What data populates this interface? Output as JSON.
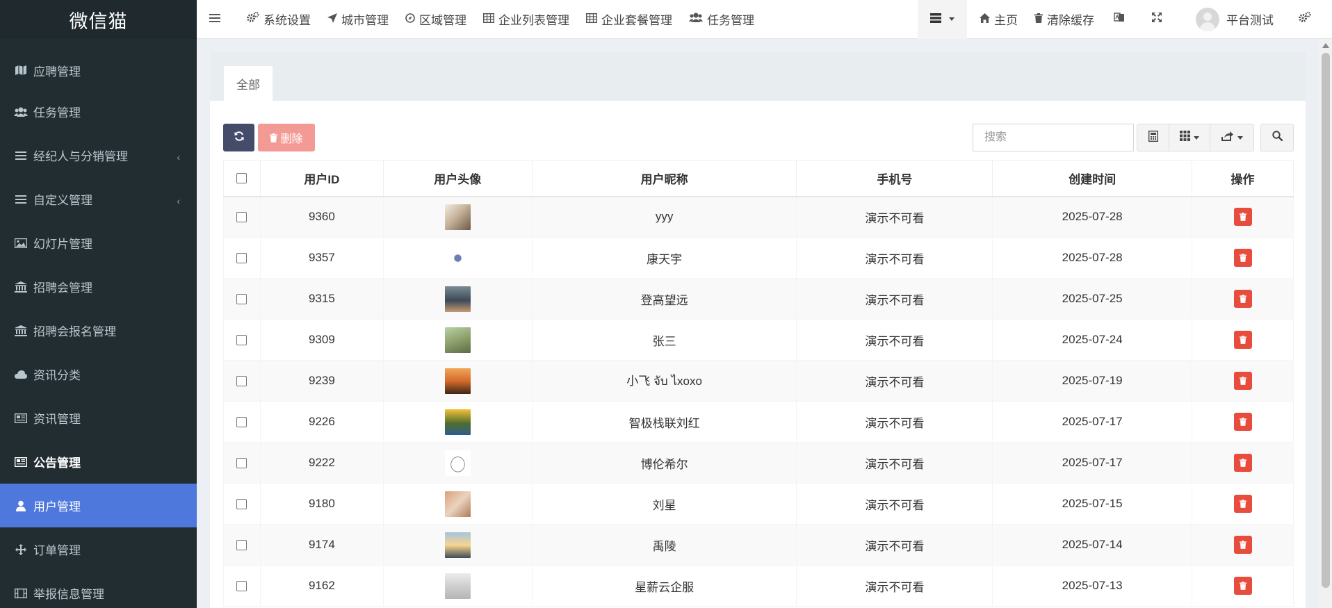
{
  "app": {
    "logo": "微信猫"
  },
  "sidebar": {
    "items": [
      {
        "label": "应聘管理",
        "icon": "map-icon"
      },
      {
        "label": "任务管理",
        "icon": "users-icon"
      },
      {
        "label": "经纪人与分销管理",
        "icon": "list-icon",
        "expandable": true
      },
      {
        "label": "自定义管理",
        "icon": "list-icon",
        "expandable": true
      },
      {
        "label": "幻灯片管理",
        "icon": "image-icon"
      },
      {
        "label": "招聘会管理",
        "icon": "bank-icon"
      },
      {
        "label": "招聘会报名管理",
        "icon": "bank-icon"
      },
      {
        "label": "资讯分类",
        "icon": "cloud-icon"
      },
      {
        "label": "资讯管理",
        "icon": "newspaper-icon"
      },
      {
        "label": "公告管理",
        "icon": "newspaper-icon",
        "highlighted": true
      },
      {
        "label": "用户管理",
        "icon": "user-icon",
        "active": true
      },
      {
        "label": "订单管理",
        "icon": "arrows-icon"
      },
      {
        "label": "举报信息管理",
        "icon": "film-icon"
      }
    ]
  },
  "topnav": {
    "menu": [
      "系统设置",
      "城市管理",
      "区域管理",
      "企业列表管理",
      "企业套餐管理",
      "任务管理"
    ],
    "home": "主页",
    "clear_cache": "清除缓存",
    "user_name": "平台测试"
  },
  "panel": {
    "tab_all": "全部"
  },
  "toolbar": {
    "delete_label": "删除",
    "search_placeholder": "搜索"
  },
  "table": {
    "columns": [
      "用户ID",
      "用户头像",
      "用户昵称",
      "手机号",
      "创建时间",
      "操作"
    ],
    "rows": [
      {
        "id": "9360",
        "nickname": "yyy",
        "phone": "演示不可看",
        "created": "2025-07-28"
      },
      {
        "id": "9357",
        "nickname": "康天宇",
        "phone": "演示不可看",
        "created": "2025-07-28"
      },
      {
        "id": "9315",
        "nickname": "登高望远",
        "phone": "演示不可看",
        "created": "2025-07-25"
      },
      {
        "id": "9309",
        "nickname": "张三",
        "phone": "演示不可看",
        "created": "2025-07-24"
      },
      {
        "id": "9239",
        "nickname": "小飞 จับ ไxoxo",
        "phone": "演示不可看",
        "created": "2025-07-19"
      },
      {
        "id": "9226",
        "nickname": "智极栈联刘红",
        "phone": "演示不可看",
        "created": "2025-07-17"
      },
      {
        "id": "9222",
        "nickname": "博伦希尔",
        "phone": "演示不可看",
        "created": "2025-07-17"
      },
      {
        "id": "9180",
        "nickname": "刘星",
        "phone": "演示不可看",
        "created": "2025-07-15"
      },
      {
        "id": "9174",
        "nickname": "禹陵",
        "phone": "演示不可看",
        "created": "2025-07-14"
      },
      {
        "id": "9162",
        "nickname": "星薪云企服",
        "phone": "演示不可看",
        "created": "2025-07-13"
      }
    ]
  },
  "colors": {
    "sidebar_bg": "#222d32",
    "active": "#4f78dc",
    "danger": "#e74c3c",
    "refresh_btn": "#444c69"
  }
}
